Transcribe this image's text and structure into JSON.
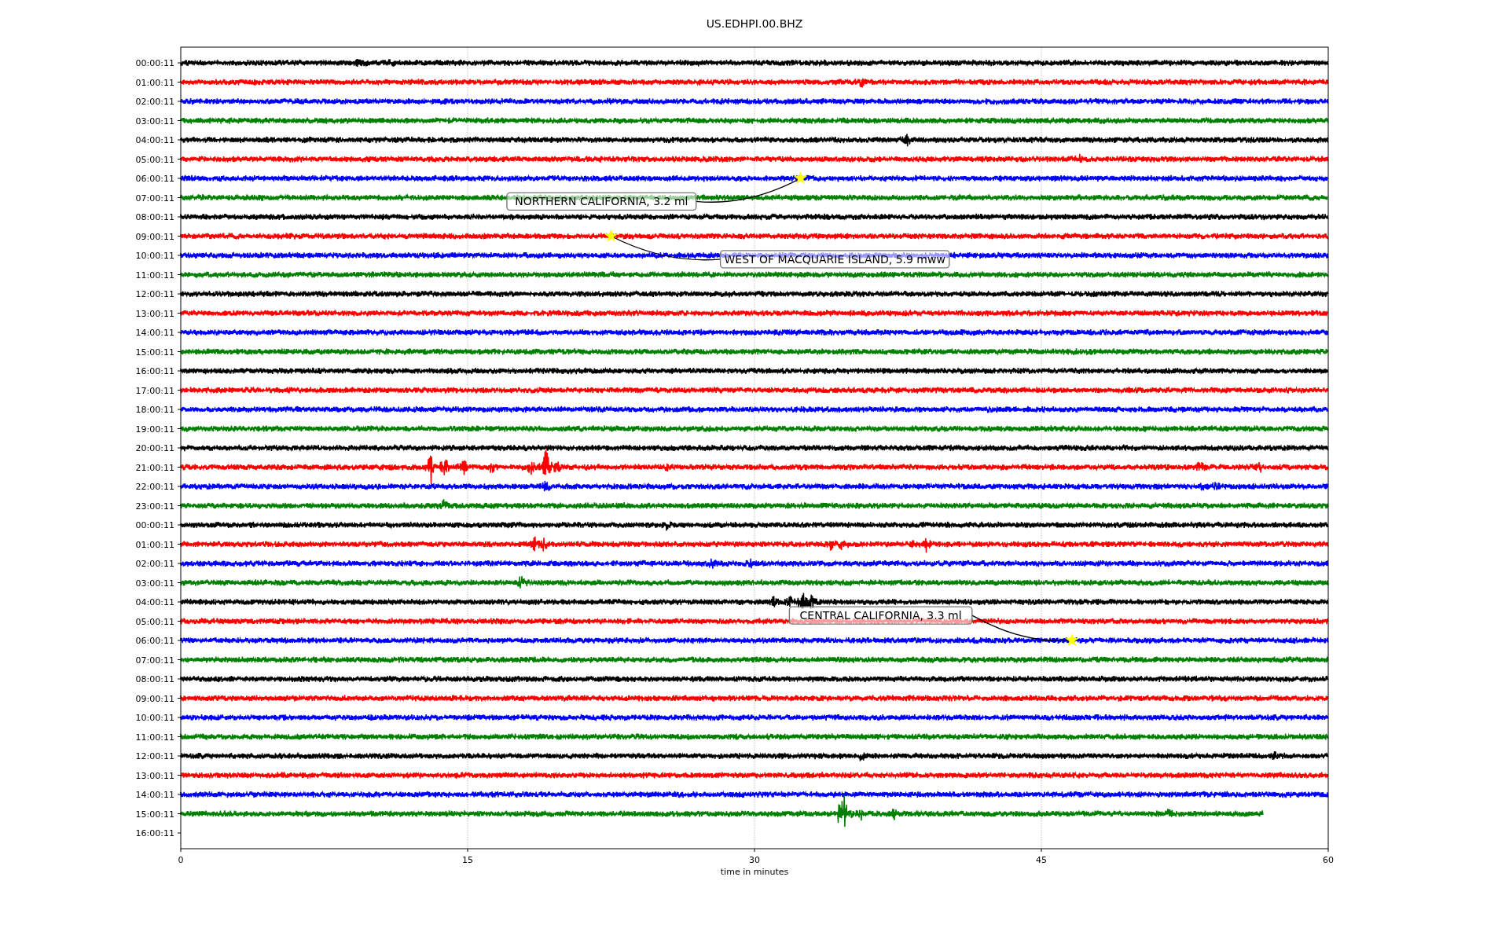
{
  "plot": {
    "title": "US.EDHPI.00.BHZ",
    "xlabel": "time in minutes",
    "x_tick_labels": [
      "0",
      "15",
      "30",
      "45",
      "60"
    ],
    "rows": [
      {
        "label": "00:00:11",
        "color": "#000000"
      },
      {
        "label": "01:00:11",
        "color": "#ff0000"
      },
      {
        "label": "02:00:11",
        "color": "#0000ff"
      },
      {
        "label": "03:00:11",
        "color": "#008000"
      },
      {
        "label": "04:00:11",
        "color": "#000000"
      },
      {
        "label": "05:00:11",
        "color": "#ff0000"
      },
      {
        "label": "06:00:11",
        "color": "#0000ff"
      },
      {
        "label": "07:00:11",
        "color": "#008000"
      },
      {
        "label": "08:00:11",
        "color": "#000000"
      },
      {
        "label": "09:00:11",
        "color": "#ff0000"
      },
      {
        "label": "10:00:11",
        "color": "#0000ff"
      },
      {
        "label": "11:00:11",
        "color": "#008000"
      },
      {
        "label": "12:00:11",
        "color": "#000000"
      },
      {
        "label": "13:00:11",
        "color": "#ff0000"
      },
      {
        "label": "14:00:11",
        "color": "#0000ff"
      },
      {
        "label": "15:00:11",
        "color": "#008000"
      },
      {
        "label": "16:00:11",
        "color": "#000000"
      },
      {
        "label": "17:00:11",
        "color": "#ff0000"
      },
      {
        "label": "18:00:11",
        "color": "#0000ff"
      },
      {
        "label": "19:00:11",
        "color": "#008000"
      },
      {
        "label": "20:00:11",
        "color": "#000000"
      },
      {
        "label": "21:00:11",
        "color": "#ff0000"
      },
      {
        "label": "22:00:11",
        "color": "#0000ff"
      },
      {
        "label": "23:00:11",
        "color": "#008000"
      },
      {
        "label": "00:00:11",
        "color": "#000000"
      },
      {
        "label": "01:00:11",
        "color": "#ff0000"
      },
      {
        "label": "02:00:11",
        "color": "#0000ff"
      },
      {
        "label": "03:00:11",
        "color": "#008000"
      },
      {
        "label": "04:00:11",
        "color": "#000000"
      },
      {
        "label": "05:00:11",
        "color": "#ff0000"
      },
      {
        "label": "06:00:11",
        "color": "#0000ff"
      },
      {
        "label": "07:00:11",
        "color": "#008000"
      },
      {
        "label": "08:00:11",
        "color": "#000000"
      },
      {
        "label": "09:00:11",
        "color": "#ff0000"
      },
      {
        "label": "10:00:11",
        "color": "#0000ff"
      },
      {
        "label": "11:00:11",
        "color": "#008000"
      },
      {
        "label": "12:00:11",
        "color": "#000000"
      },
      {
        "label": "13:00:11",
        "color": "#ff0000"
      },
      {
        "label": "14:00:11",
        "color": "#0000ff"
      },
      {
        "label": "15:00:11",
        "color": "#008000"
      },
      {
        "label": "16:00:11"
      }
    ],
    "events": [
      {
        "text": "NORTHERN CALIFORNIA, 3.2 ml"
      },
      {
        "text": "WEST OF MACQUARIE ISLAND, 5.9 mww"
      },
      {
        "text": "CENTRAL CALIFORNIA, 3.3 ml"
      }
    ]
  }
}
